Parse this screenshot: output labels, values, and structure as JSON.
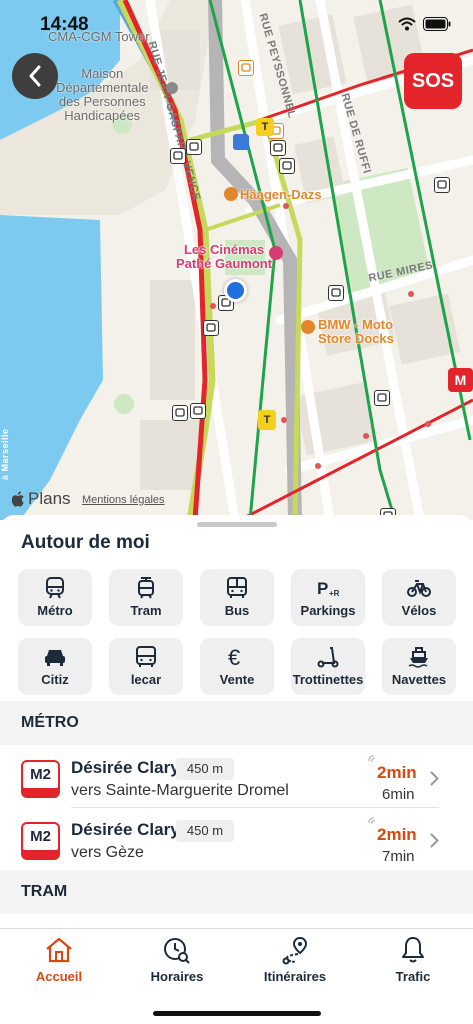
{
  "status_bar": {
    "time": "14:48"
  },
  "map": {
    "labels": {
      "poi_cma": "CMA-CGM Tower",
      "poi_maison": "Maison\nDépartementale\ndes Personnes\nHandicapées",
      "street_vence": "RUE JEAN-GASPARD VENCE",
      "street_peyssonnel": "RUE PEYSSONNEL",
      "street_ruffi": "RUE DE RUFFI",
      "street_mires": "RUE MIRES",
      "poi_haagen": "Häagen-Dazs",
      "poi_cinemas": "Les Cinémas\nPathé Gaumont",
      "poi_bmw": "BMW - Moto\nStore Docks",
      "side_label": "à Marseille"
    },
    "plans_text": "Plans",
    "legal_text": "Mentions légales",
    "sos_label": "SOS"
  },
  "sheet": {
    "title": "Autour de moi",
    "categories": [
      {
        "label": "Métro",
        "icon": "metro-icon"
      },
      {
        "label": "Tram",
        "icon": "tram-icon"
      },
      {
        "label": "Bus",
        "icon": "bus-icon"
      },
      {
        "label": "Parkings",
        "icon": "parking-icon"
      },
      {
        "label": "Vélos",
        "icon": "bike-icon"
      },
      {
        "label": "Citiz",
        "icon": "car-icon"
      },
      {
        "label": "lecar",
        "icon": "lecar-icon"
      },
      {
        "label": "Vente",
        "icon": "euro-icon"
      },
      {
        "label": "Trottinettes",
        "icon": "scooter-icon"
      },
      {
        "label": "Navettes",
        "icon": "ferry-icon"
      }
    ],
    "metro_section": {
      "title": "MÉTRO",
      "rows": [
        {
          "line": "M2",
          "stop": "Désirée Clary",
          "distance": "450 m",
          "direction": "vers Sainte-Marguerite Dromel",
          "next": "2min",
          "following": "6min"
        },
        {
          "line": "M2",
          "stop": "Désirée Clary",
          "distance": "450 m",
          "direction": "vers Gèze",
          "next": "2min",
          "following": "7min"
        }
      ]
    },
    "tram_section": {
      "title": "TRAM"
    }
  },
  "tabbar": {
    "tabs": [
      {
        "label": "Accueil",
        "icon": "home-icon",
        "active": true
      },
      {
        "label": "Horaires",
        "icon": "schedule-icon",
        "active": false
      },
      {
        "label": "Itinéraires",
        "icon": "route-icon",
        "active": false
      },
      {
        "label": "Trafic",
        "icon": "bell-icon",
        "active": false
      }
    ]
  },
  "colors": {
    "accent": "#d9480f",
    "sos_red": "#e3242b",
    "metro_line": "#e3242b",
    "tram_line": "#a8c42e",
    "bus_line": "#1fa34a",
    "location_blue": "#1f6fdc"
  }
}
